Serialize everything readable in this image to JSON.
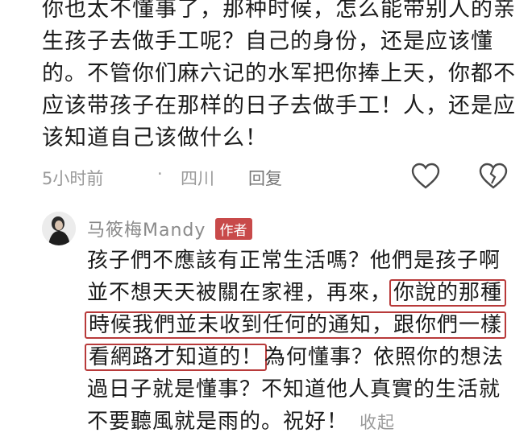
{
  "comment": {
    "lines": [
      "你也太不懂事了，那种时候，怎么能带别人的亲",
      "生孩子去做手工呢？自己的身份，还是应该懂",
      "的。不管你们麻六记的水军把你捧上天，你都不",
      "应该带孩子在那样的日子去做手工！人，还是应",
      "该知道自己该做什么！"
    ],
    "time": "5小时前",
    "separator": "·",
    "location": "四川",
    "reply_label": "回复",
    "like_icon": "heart-outline-icon",
    "dislike_icon": "broken-heart-icon"
  },
  "reply": {
    "author": "马筱梅Mandy",
    "badge": "作者",
    "line1": "孩子們不應該有正常生活嗎？他們是孩子啊",
    "line2_plain": "並不想天天被關在家裡，再來，",
    "line2_hl": "你說的那種",
    "line3_hl": "時候我們並未收到任何的通知，跟你們一樣",
    "line4_hl": "看網路才知道的！",
    "line4_plain": "為何懂事？依照你的想法",
    "line5": "過日子就是懂事？不知道他人真實的生活就",
    "line6": "不要聽風就是雨的。祝好！",
    "collapse_label": "收起",
    "highlight_color": "#b83a3a"
  }
}
